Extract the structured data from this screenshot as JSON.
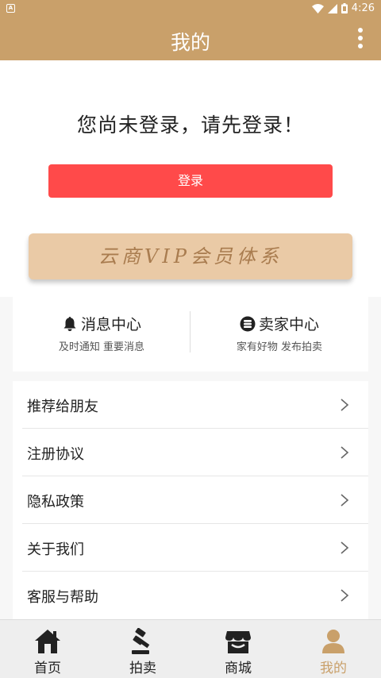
{
  "status_bar": {
    "left_badge": "A",
    "time": "4:26"
  },
  "title_bar": {
    "title": "我的",
    "more_icon": "more-vertical-icon"
  },
  "login": {
    "prompt": "您尚未登录，请先登录！",
    "button_label": "登录"
  },
  "vip_banner": {
    "text": "云商VIP会员体系"
  },
  "quick_actions": [
    {
      "icon": "bell-icon",
      "title": "消息中心",
      "subtitle": "及时通知 重要消息"
    },
    {
      "icon": "coins-icon",
      "title": "卖家中心",
      "subtitle": "家有好物 发布拍卖"
    }
  ],
  "menu": {
    "items": [
      {
        "label": "推荐给朋友"
      },
      {
        "label": "注册协议"
      },
      {
        "label": "隐私政策"
      },
      {
        "label": "关于我们"
      },
      {
        "label": "客服与帮助"
      }
    ]
  },
  "bottom_nav": {
    "items": [
      {
        "label": "首页",
        "icon": "home-icon"
      },
      {
        "label": "拍卖",
        "icon": "gavel-icon"
      },
      {
        "label": "商城",
        "icon": "store-icon"
      },
      {
        "label": "我的",
        "icon": "person-icon"
      }
    ],
    "active_index": 3
  },
  "colors": {
    "brand": "#c9a06a",
    "login_button": "#ff4a4a",
    "vip_banner": "#eacaa6",
    "active_nav": "#c9a06a"
  }
}
